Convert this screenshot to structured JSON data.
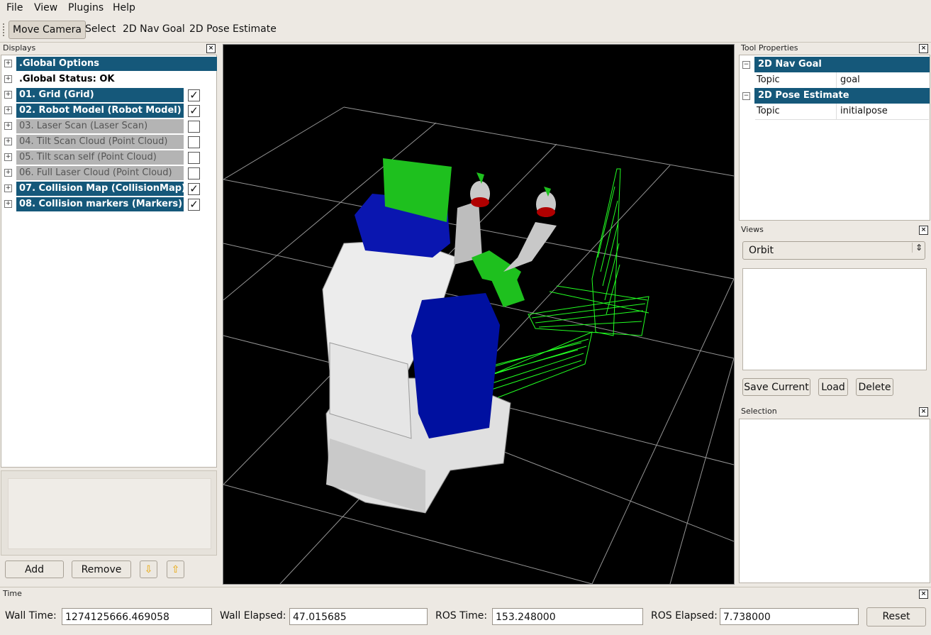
{
  "menu": [
    "File",
    "View",
    "Plugins",
    "Help"
  ],
  "toolbar": {
    "tools": [
      "Move Camera",
      "Select",
      "2D Nav Goal",
      "2D Pose Estimate"
    ]
  },
  "displays": {
    "title": "Displays",
    "rows": [
      {
        "label": ".Global Options",
        "checked": null
      },
      {
        "label": ".Global Status: OK",
        "checked": null
      },
      {
        "label": "01. Grid (Grid)",
        "checked": true
      },
      {
        "label": "02. Robot Model (Robot Model)",
        "checked": true
      },
      {
        "label": "03. Laser Scan (Laser Scan)",
        "checked": false
      },
      {
        "label": "04. Tilt Scan Cloud (Point Cloud)",
        "checked": false
      },
      {
        "label": "05. Tilt scan self (Point Cloud)",
        "checked": false
      },
      {
        "label": "06. Full Laser Cloud (Point Cloud)",
        "checked": false
      },
      {
        "label": "07. Collision Map (CollisionMap)",
        "checked": true
      },
      {
        "label": "08. Collision markers (Markers)",
        "checked": true
      }
    ],
    "add": "Add",
    "remove": "Remove",
    "check_mark": "✓"
  },
  "tool_properties": {
    "title": "Tool Properties",
    "sections": [
      {
        "name": "2D Nav Goal",
        "prop": "Topic",
        "value": "goal"
      },
      {
        "name": "2D Pose Estimate",
        "prop": "Topic",
        "value": "initialpose"
      }
    ]
  },
  "views": {
    "title": "Views",
    "selected": "Orbit",
    "save": "Save Current",
    "load": "Load",
    "delete": "Delete"
  },
  "selection": {
    "title": "Selection"
  },
  "time": {
    "title": "Time",
    "wall_time_label": "Wall Time:",
    "wall_time": "1274125666.469058",
    "wall_elapsed_label": "Wall Elapsed:",
    "wall_elapsed": "47.015685",
    "ros_time_label": "ROS Time:",
    "ros_time": "153.248000",
    "ros_elapsed_label": "ROS Elapsed:",
    "ros_elapsed": "7.738000",
    "reset": "Reset"
  },
  "colors": {
    "selected_row": "#15587a",
    "disabled_row": "#b4b4b4",
    "robot_white": "#e8e8e8",
    "robot_blue": "#0010a0",
    "robot_green": "#1ec01e",
    "point_cloud": "#22ff22",
    "viewport_bg": "#000000"
  }
}
